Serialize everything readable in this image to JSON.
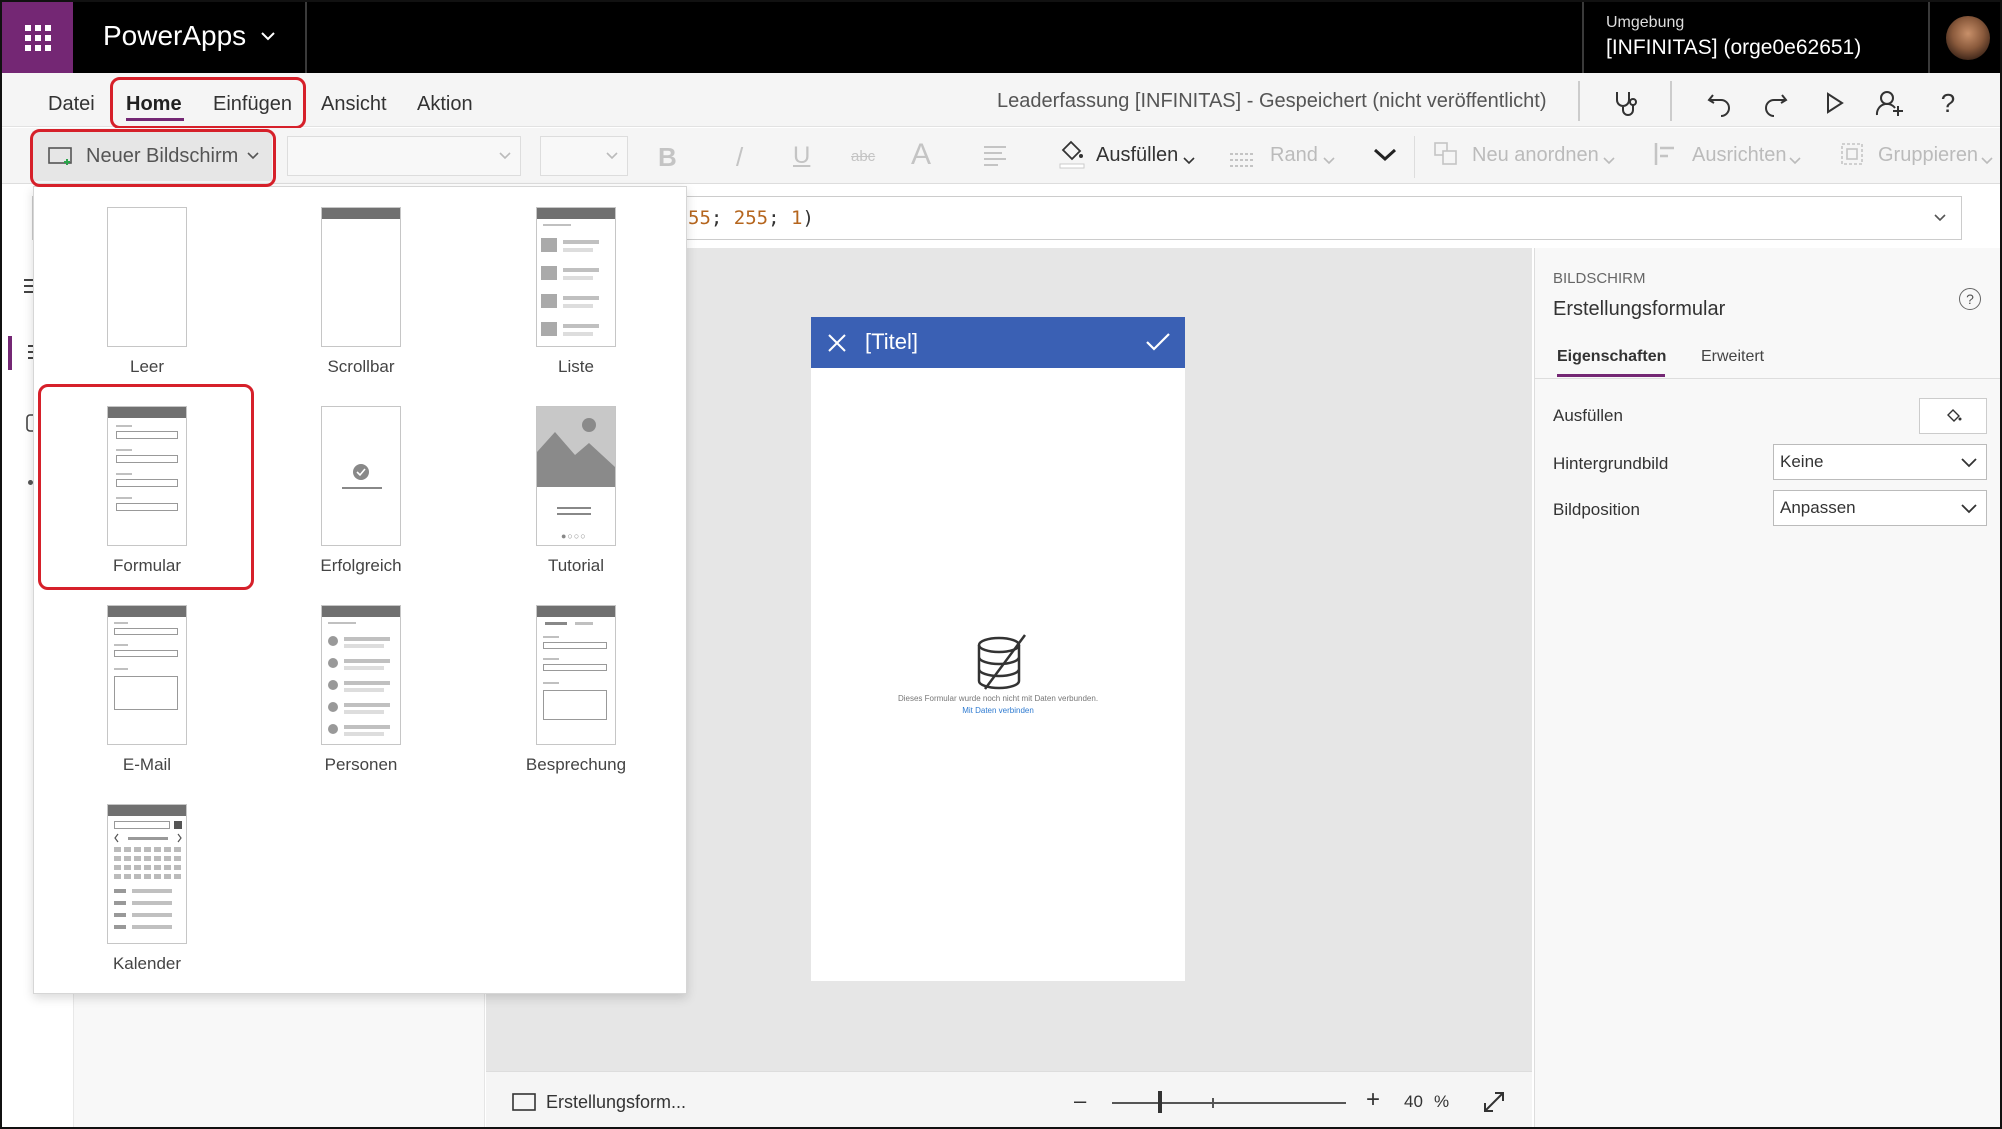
{
  "topbar": {
    "app_name": "PowerApps",
    "env_label": "Umgebung",
    "env_value": "[INFINITAS] (orge0e62651)"
  },
  "menu": {
    "items": [
      "Datei",
      "Home",
      "Einfügen",
      "Ansicht",
      "Aktion"
    ],
    "doc_title": "Leaderfassung [INFINITAS] - Gespeichert (nicht veröffentlicht)"
  },
  "toolbar": {
    "new_screen": "Neuer Bildschirm",
    "bold": "B",
    "italic": "/",
    "underline": "U",
    "strike": "abc",
    "font_size_glyph": "A",
    "fill": "Ausfüllen",
    "border": "Rand",
    "reorder": "Neu anordnen",
    "align": "Ausrichten",
    "group": "Gruppieren"
  },
  "formula": {
    "num1": "55",
    "sep1": "; ",
    "num2": "255",
    "sep2": "; ",
    "num3": "1",
    "close": ")"
  },
  "templates": [
    {
      "label": "Leer",
      "icon": "blank-template-icon"
    },
    {
      "label": "Scrollbar",
      "icon": "scrollable-template-icon"
    },
    {
      "label": "Liste",
      "icon": "list-template-icon"
    },
    {
      "label": "Formular",
      "icon": "form-template-icon"
    },
    {
      "label": "Erfolgreich",
      "icon": "success-template-icon"
    },
    {
      "label": "Tutorial",
      "icon": "tutorial-template-icon"
    },
    {
      "label": "E-Mail",
      "icon": "email-template-icon"
    },
    {
      "label": "Personen",
      "icon": "people-template-icon"
    },
    {
      "label": "Besprechung",
      "icon": "meeting-template-icon"
    },
    {
      "label": "Kalender",
      "icon": "calendar-template-icon"
    }
  ],
  "phone": {
    "title": "[Titel]",
    "message": "Dieses Formular wurde noch nicht mit Daten verbunden.",
    "link": "Mit Daten verbinden"
  },
  "statusbar": {
    "screen_name": "Erstellungsform...",
    "zoom_value": "40",
    "zoom_unit": "%"
  },
  "rightpanel": {
    "kind": "BILDSCHIRM",
    "name": "Erstellungsformular",
    "tab_properties": "Eigenschaften",
    "tab_advanced": "Erweitert",
    "fill_label": "Ausfüllen",
    "bgimage_label": "Hintergrundbild",
    "bgimage_value": "Keine",
    "imgpos_label": "Bildposition",
    "imgpos_value": "Anpassen"
  },
  "colors": {
    "brand_purple": "#742774",
    "header_blue": "#3a60b4",
    "highlight_red": "#d6202a"
  }
}
